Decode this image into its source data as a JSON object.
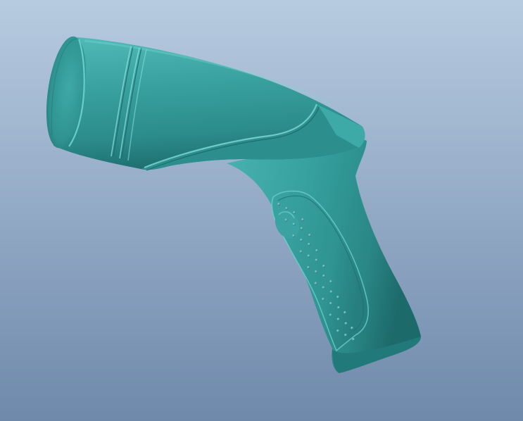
{
  "viewport": {
    "background_top": "#b7cbe0",
    "background_bottom": "#6f89ab"
  },
  "model": {
    "object": "handheld-scanner-housing",
    "surface_color": "#3aa2a0",
    "surface_light": "#6fd3cf",
    "surface_dark": "#1f6f70",
    "grip_texture": "dotted"
  }
}
